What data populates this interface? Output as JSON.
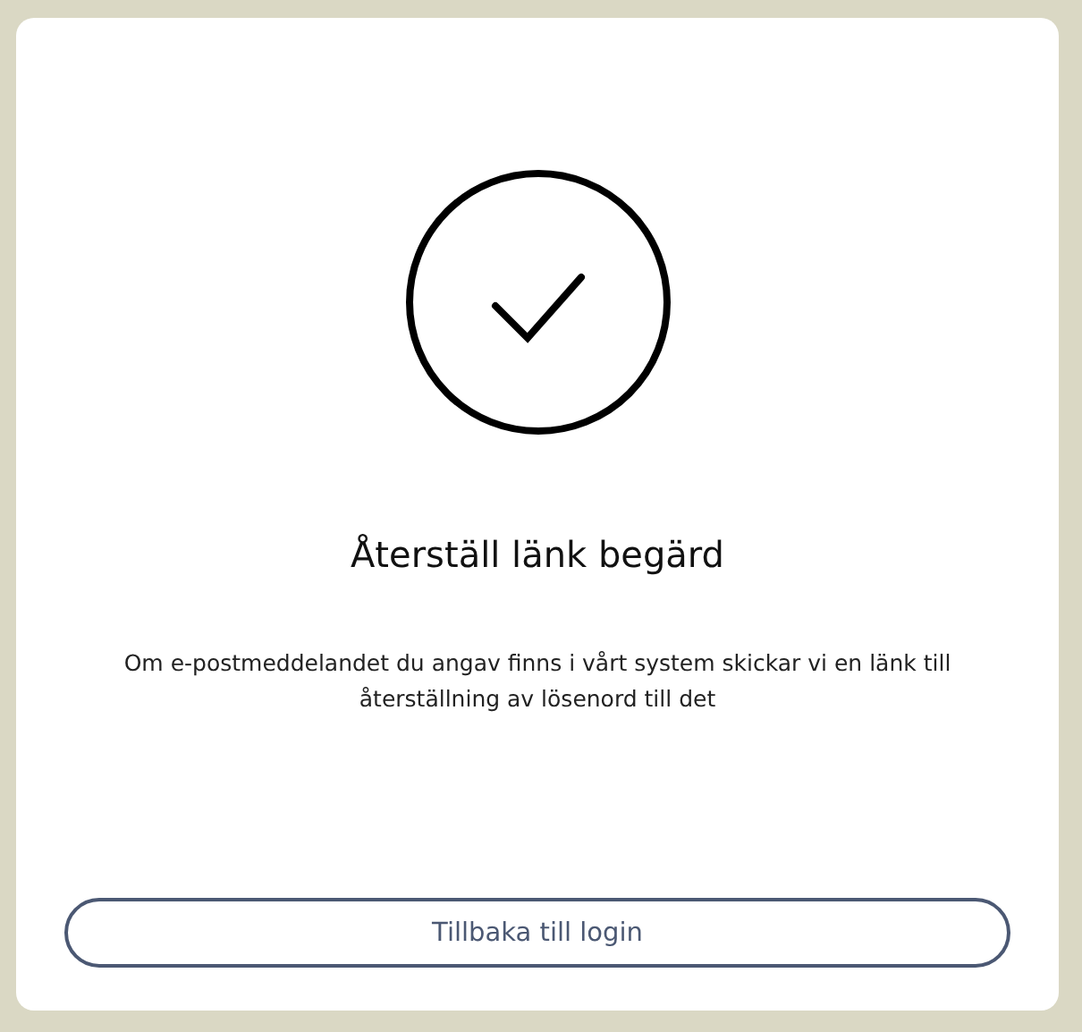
{
  "title": "Återställ länk begärd",
  "message": "Om e-postmeddelandet du angav finns i vårt system skickar vi en länk till återställning av lösenord till det",
  "button": {
    "label": "Tillbaka till login"
  }
}
